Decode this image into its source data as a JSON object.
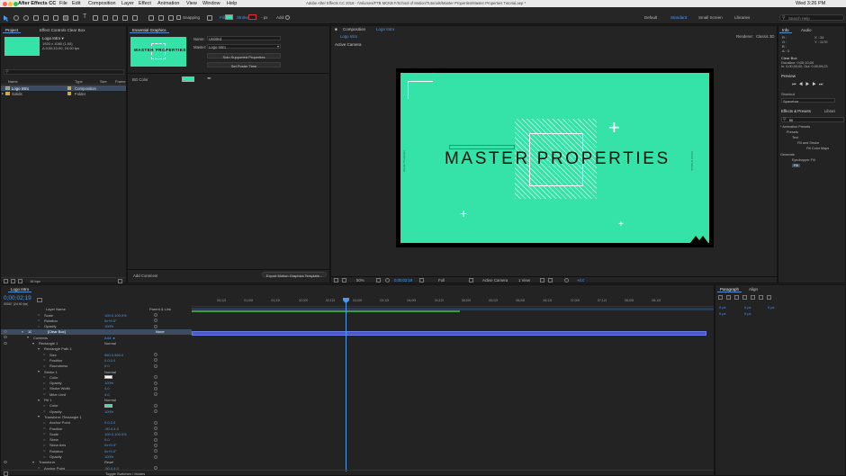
{
  "menubar": {
    "app_name": "After Effects CC",
    "items": [
      "File",
      "Edit",
      "Composition",
      "Layer",
      "Effect",
      "Animation",
      "View",
      "Window",
      "Help"
    ],
    "title": "Adobe After Effects CC 2018 - /Volumes/FTB MCKB F/School of Motion/Tutorials/Master Properties/Master Properties Tutorial.aep *",
    "clock": "Wed 3:26 PM"
  },
  "toolbar": {
    "snapping": "Snapping",
    "fill_label": "Fill:",
    "stroke_label": "Stroke:",
    "stroke_value": "- px",
    "add_label": "Add:",
    "workspaces": [
      "Default",
      "Standard",
      "Small Screen",
      "Libraries"
    ],
    "search_placeholder": "Search Help"
  },
  "project": {
    "tab": "Project",
    "effect_controls_tab": "Effect Controls Clear Box",
    "comp_name": "Logo Intro ▾",
    "comp_dims": "1920 x 1080 (1.00)",
    "comp_duration": "Δ 0;00;10;00, 24.00 fps",
    "columns": [
      "Name",
      "Type",
      "Size",
      "Frame"
    ],
    "items": [
      {
        "name": "Logo Intro",
        "type": "Composition"
      },
      {
        "name": "Solids",
        "type": "Folder"
      }
    ],
    "bpc": "16 bpc"
  },
  "essential": {
    "tab": "Essential Graphics",
    "thumb_text": "MASTER PROPERTIES",
    "name_label": "Name:",
    "name_value": "Untitled",
    "master_label": "Master:",
    "master_value": "Logo Intro",
    "solo_btn": "Solo Supported Properties",
    "poster_btn": "Set Poster Time",
    "prop_label": "BG Color",
    "add_comment": "Add Comment",
    "export_btn": "Export Motion Graphics Template..."
  },
  "viewer": {
    "tab_prefix": "Composition",
    "tab_name": "Logo Intro",
    "breadcrumb": "Logo Intro",
    "renderer_label": "Renderer:",
    "renderer": "Classic 3D",
    "camera": "Active Camera",
    "title_text": "MASTER PROPERTIES",
    "side_left": "Master Properties",
    "side_right": "School of Motion",
    "bg_color": "#35e3a8",
    "bottom": {
      "zoom": "50%",
      "timecode": "0;00;02;19",
      "resolution": "Full",
      "camera": "Active Camera",
      "views": "1 View",
      "exposure": "+0.0"
    }
  },
  "info": {
    "tabs": [
      "Info",
      "Audio"
    ],
    "rgb": [
      "R :",
      "G :",
      "B :",
      "A : 0"
    ],
    "xy": [
      "X : 34",
      "Y : 1170"
    ],
    "layer_name": "Clear Box",
    "duration": "Duration: 0;00;10;00",
    "in_out": "In: 0;00;00;00, Out: 0;00;09;23",
    "preview_tab": "Preview",
    "shortcut_label": "Shortcut",
    "shortcut_value": "Spacebar",
    "effects_tab": "Effects & Presets",
    "library_tab": "Librari",
    "search_value": "fill",
    "tree": [
      "* Animation Presets",
      "Presets",
      "Text",
      "Fill and Stroke",
      "Fill Color Maps",
      "Generate",
      "Eyedropper Fill",
      "Fill"
    ]
  },
  "paragraph": {
    "tabs": [
      "Paragraph",
      "Align"
    ],
    "values": [
      "0 px",
      "0 px",
      "0 px",
      "0 px",
      "0 px"
    ]
  },
  "timeline": {
    "tab": "Logo Intro",
    "timecode": "0;00;02;19",
    "frame": "00067 (24.00 fps)",
    "columns": [
      "Layer Name",
      "Parent & Link"
    ],
    "ruler": [
      "00;12f",
      "01;00f",
      "01;12f",
      "02;00f",
      "02;12f",
      "03;00f",
      "03;12f",
      "04;00f",
      "04;12f",
      "05;00f",
      "05;12f",
      "06;00f",
      "06;12f",
      "07;00f",
      "07;12f",
      "08;00f",
      "08;12f"
    ],
    "toggle_label": "Toggle Switches / Modes",
    "rows": [
      {
        "indent": 3,
        "label": "Scale",
        "value": "100.0,100.0%",
        "type": "prop"
      },
      {
        "indent": 3,
        "label": "Rotation",
        "value": "0x+0.0°",
        "type": "prop"
      },
      {
        "indent": 3,
        "label": "Opacity",
        "value": "100%",
        "type": "prop"
      },
      {
        "indent": 0,
        "label": "[Clear Box]",
        "num": "10",
        "mode": "None",
        "type": "layer"
      },
      {
        "indent": 1,
        "label": "Contents",
        "value": "Add: ●",
        "type": "group"
      },
      {
        "indent": 2,
        "label": "Rectangle 1",
        "value": "Normal",
        "type": "group"
      },
      {
        "indent": 3,
        "label": "Rectangle Path 1",
        "value": "",
        "type": "group"
      },
      {
        "indent": 4,
        "label": "Size",
        "value": "560.0,560.0",
        "type": "prop"
      },
      {
        "indent": 4,
        "label": "Position",
        "value": "0.0,0.0",
        "type": "prop"
      },
      {
        "indent": 4,
        "label": "Roundness",
        "value": "0.0",
        "type": "prop"
      },
      {
        "indent": 3,
        "label": "Stroke 1",
        "value": "Normal",
        "type": "group"
      },
      {
        "indent": 4,
        "label": "Color",
        "value": "",
        "type": "color_white"
      },
      {
        "indent": 4,
        "label": "Opacity",
        "value": "100%",
        "type": "prop"
      },
      {
        "indent": 4,
        "label": "Stroke Width",
        "value": "4.0",
        "type": "prop"
      },
      {
        "indent": 4,
        "label": "Miter Limit",
        "value": "4.0",
        "type": "prop"
      },
      {
        "indent": 3,
        "label": "Fill 1",
        "value": "Normal",
        "type": "group"
      },
      {
        "indent": 4,
        "label": "Color",
        "value": "",
        "type": "color_green"
      },
      {
        "indent": 4,
        "label": "Opacity",
        "value": "100%",
        "type": "prop"
      },
      {
        "indent": 3,
        "label": "Transform: Rectangle 1",
        "value": "",
        "type": "group"
      },
      {
        "indent": 4,
        "label": "Anchor Point",
        "value": "0.0,0.0",
        "type": "prop"
      },
      {
        "indent": 4,
        "label": "Position",
        "value": "-50.0,4.0",
        "type": "prop"
      },
      {
        "indent": 4,
        "label": "Scale",
        "value": "100.0,100.0%",
        "type": "prop"
      },
      {
        "indent": 4,
        "label": "Skew",
        "value": "0.0",
        "type": "prop"
      },
      {
        "indent": 4,
        "label": "Skew Axis",
        "value": "0x+0.0°",
        "type": "prop"
      },
      {
        "indent": 4,
        "label": "Rotation",
        "value": "0x+0.0°",
        "type": "prop"
      },
      {
        "indent": 4,
        "label": "Opacity",
        "value": "100%",
        "type": "prop"
      },
      {
        "indent": 2,
        "label": "Transform",
        "value": "Reset",
        "type": "group"
      },
      {
        "indent": 3,
        "label": "Anchor Point",
        "value": "-50.0,4.0",
        "type": "prop"
      }
    ]
  }
}
